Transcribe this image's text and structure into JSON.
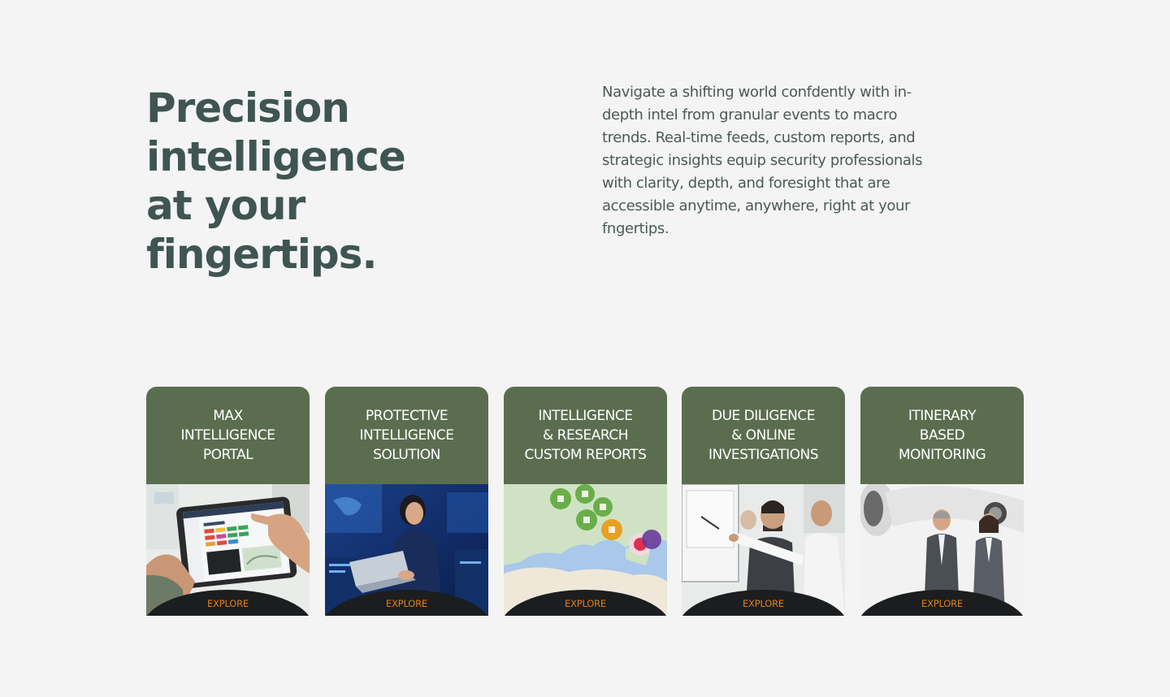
{
  "hero": {
    "headline": "Precision\nintelligence\nat your\nfingertips.",
    "description": "Navigate a shifting world confdently with in-depth intel from granular events to macro trends. Real-time feeds, custom reports, and strategic insights equip security professionals with clarity, depth, and foresight that are accessible anytime, anywhere, right at your fngertips."
  },
  "cards": [
    {
      "title": "MAX\nINTELLIGENCE\nPORTAL",
      "cta": "EXPLORE",
      "image_icon": "tablet-dashboard-photo"
    },
    {
      "title": "PROTECTIVE\nINTELLIGENCE\nSOLUTION",
      "cta": "EXPLORE",
      "image_icon": "analyst-laptop-photo"
    },
    {
      "title": "INTELLIGENCE\n& RESEARCH\nCUSTOM REPORTS",
      "cta": "EXPLORE",
      "image_icon": "europe-map-pins-photo"
    },
    {
      "title": "DUE DILIGENCE\n& ONLINE\nINVESTIGATIONS",
      "cta": "EXPLORE",
      "image_icon": "team-screen-meeting-photo"
    },
    {
      "title": "ITINERARY\nBASED\nMONITORING",
      "cta": "EXPLORE",
      "image_icon": "business-travelers-jet-photo"
    }
  ],
  "colors": {
    "background": "#f4f4f4",
    "headline": "#3f5552",
    "body_text": "#4b5a58",
    "card_header": "#5a6e4f",
    "explore_bar": "#1b1d1e",
    "explore_text": "#e07f1f"
  }
}
